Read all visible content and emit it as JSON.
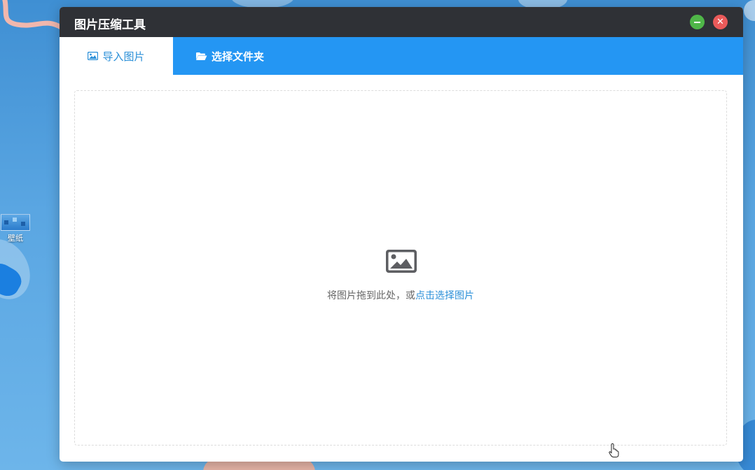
{
  "desktop": {
    "icon_label": "壁纸"
  },
  "window": {
    "title": "图片压缩工具",
    "controls": {
      "minimize_icon": "minimize-icon",
      "close_icon": "close-icon",
      "minimize_color": "#4fb648",
      "close_color": "#ea5a5a"
    }
  },
  "tabs": [
    {
      "label": "导入图片",
      "icon": "image-icon",
      "active": true
    },
    {
      "label": "选择文件夹",
      "icon": "folder-open-icon",
      "active": false
    }
  ],
  "drop_zone": {
    "icon": "image-icon",
    "text": "将图片拖到此处，或",
    "link": "点击选择图片"
  },
  "colors": {
    "titlebar": "#2f3136",
    "tab_bar": "#2496f3",
    "accent": "#2a8fd8"
  }
}
